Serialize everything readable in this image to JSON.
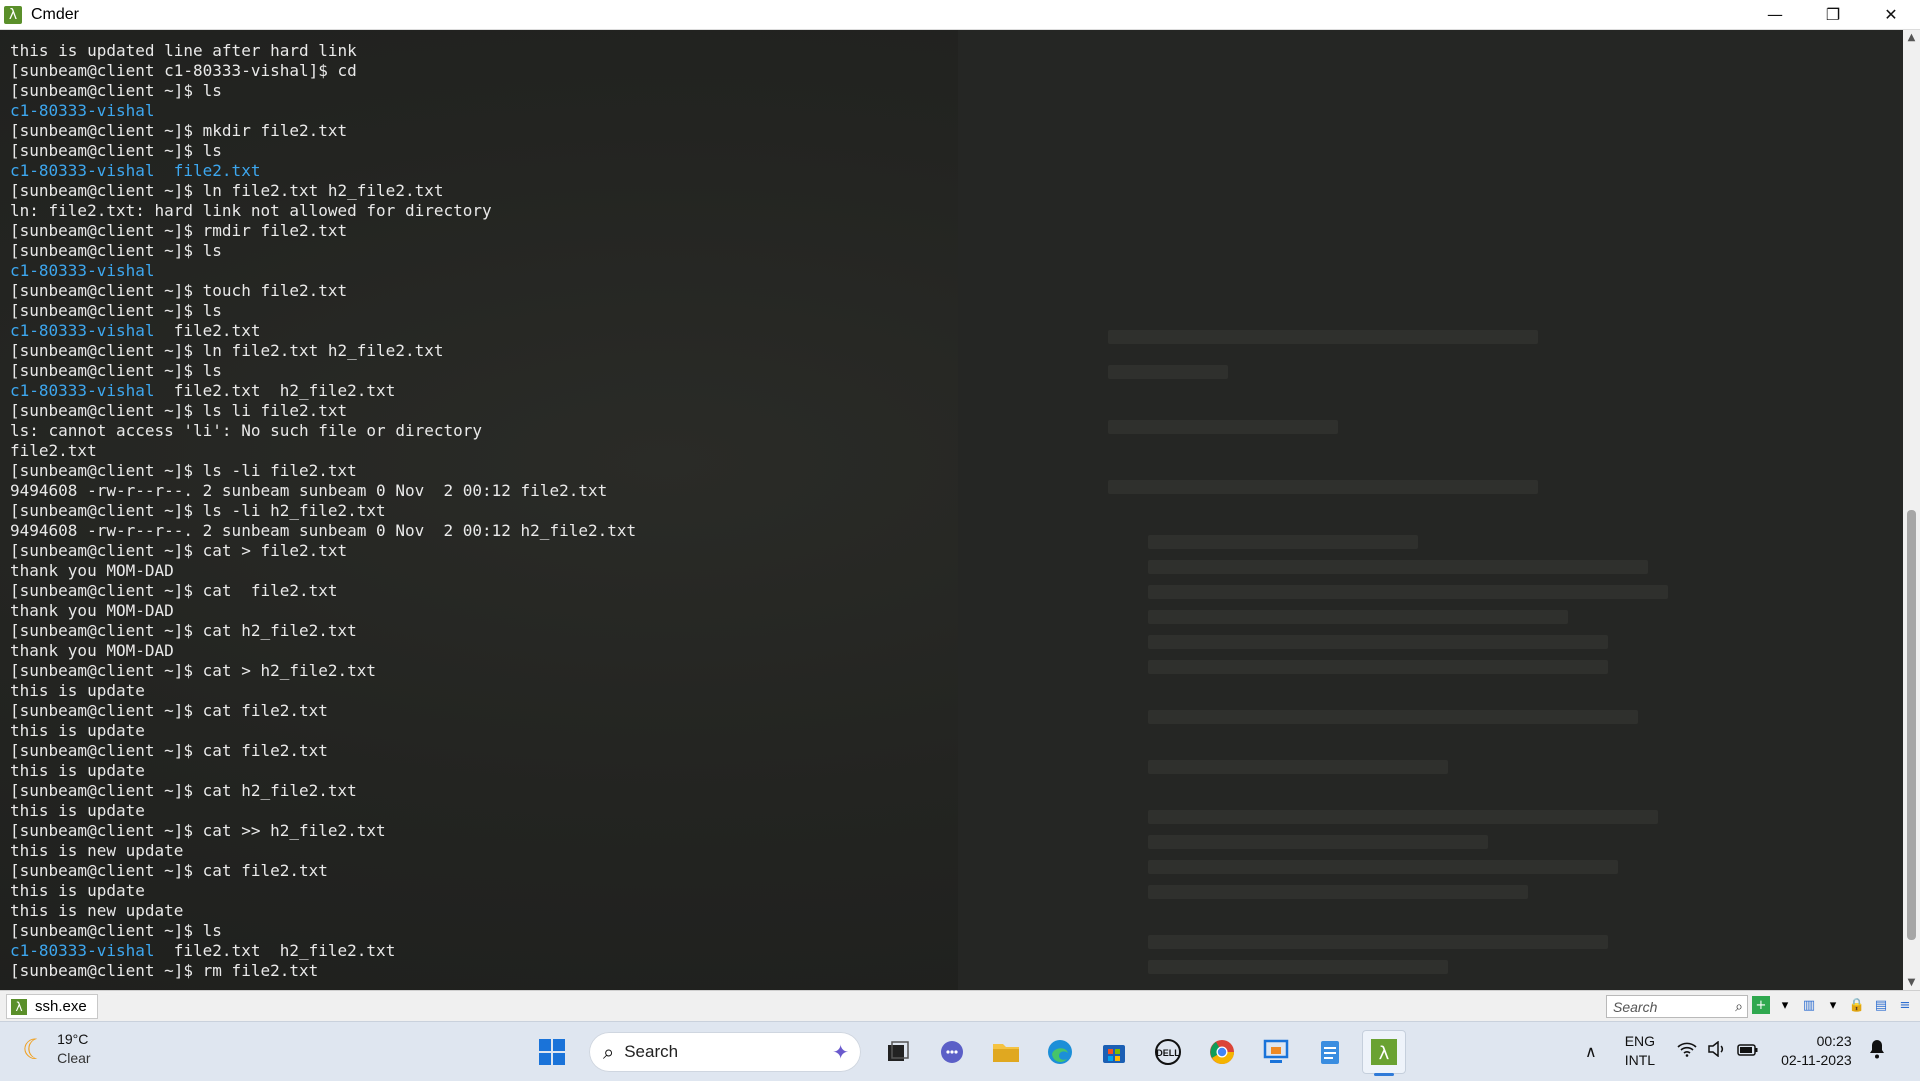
{
  "window": {
    "title": "Cmder",
    "app_icon": "λ",
    "controls": {
      "minimize": "—",
      "restore": "❐",
      "close": "✕"
    }
  },
  "terminal": {
    "colors": {
      "text": "#e9e9e9",
      "directory": "#3da7ef",
      "background": "#1b1d1b"
    },
    "lines": [
      {
        "text": "this is updated line after hard link",
        "color": "white"
      },
      {
        "text": "[sunbeam@client c1-80333-vishal]$ cd",
        "color": "white"
      },
      {
        "text": "[sunbeam@client ~]$ ls",
        "color": "white"
      },
      {
        "text": "c1-80333-vishal",
        "color": "blue"
      },
      {
        "text": "[sunbeam@client ~]$ mkdir file2.txt",
        "color": "white"
      },
      {
        "text": "[sunbeam@client ~]$ ls",
        "color": "white"
      },
      {
        "text": "c1-80333-vishal  file2.txt",
        "color": "blue"
      },
      {
        "text": "[sunbeam@client ~]$ ln file2.txt h2_file2.txt",
        "color": "white"
      },
      {
        "text": "ln: file2.txt: hard link not allowed for directory",
        "color": "white"
      },
      {
        "text": "[sunbeam@client ~]$ rmdir file2.txt",
        "color": "white"
      },
      {
        "text": "[sunbeam@client ~]$ ls",
        "color": "white"
      },
      {
        "text": "c1-80333-vishal",
        "color": "blue"
      },
      {
        "text": "[sunbeam@client ~]$ touch file2.txt",
        "color": "white"
      },
      {
        "text": "[sunbeam@client ~]$ ls",
        "color": "white"
      },
      {
        "text": "c1-80333-vishal",
        "color": "blue",
        "extra": "  file2.txt"
      },
      {
        "text": "[sunbeam@client ~]$ ln file2.txt h2_file2.txt",
        "color": "white"
      },
      {
        "text": "[sunbeam@client ~]$ ls",
        "color": "white"
      },
      {
        "text": "c1-80333-vishal",
        "color": "blue",
        "extra": "  file2.txt  h2_file2.txt"
      },
      {
        "text": "[sunbeam@client ~]$ ls li file2.txt",
        "color": "white"
      },
      {
        "text": "ls: cannot access 'li': No such file or directory",
        "color": "white"
      },
      {
        "text": "file2.txt",
        "color": "white"
      },
      {
        "text": "[sunbeam@client ~]$ ls -li file2.txt",
        "color": "white"
      },
      {
        "text": "9494608 -rw-r--r--. 2 sunbeam sunbeam 0 Nov  2 00:12 file2.txt",
        "color": "white"
      },
      {
        "text": "[sunbeam@client ~]$ ls -li h2_file2.txt",
        "color": "white"
      },
      {
        "text": "9494608 -rw-r--r--. 2 sunbeam sunbeam 0 Nov  2 00:12 h2_file2.txt",
        "color": "white"
      },
      {
        "text": "[sunbeam@client ~]$ cat > file2.txt",
        "color": "white"
      },
      {
        "text": "thank you MOM-DAD",
        "color": "white"
      },
      {
        "text": "[sunbeam@client ~]$ cat  file2.txt",
        "color": "white"
      },
      {
        "text": "thank you MOM-DAD",
        "color": "white"
      },
      {
        "text": "[sunbeam@client ~]$ cat h2_file2.txt",
        "color": "white"
      },
      {
        "text": "thank you MOM-DAD",
        "color": "white"
      },
      {
        "text": "[sunbeam@client ~]$ cat > h2_file2.txt",
        "color": "white"
      },
      {
        "text": "this is update",
        "color": "white"
      },
      {
        "text": "[sunbeam@client ~]$ cat file2.txt",
        "color": "white"
      },
      {
        "text": "this is update",
        "color": "white"
      },
      {
        "text": "[sunbeam@client ~]$ cat file2.txt",
        "color": "white"
      },
      {
        "text": "this is update",
        "color": "white"
      },
      {
        "text": "[sunbeam@client ~]$ cat h2_file2.txt",
        "color": "white"
      },
      {
        "text": "this is update",
        "color": "white"
      },
      {
        "text": "[sunbeam@client ~]$ cat >> h2_file2.txt",
        "color": "white"
      },
      {
        "text": "this is new update",
        "color": "white"
      },
      {
        "text": "[sunbeam@client ~]$ cat file2.txt",
        "color": "white"
      },
      {
        "text": "this is update",
        "color": "white"
      },
      {
        "text": "this is new update",
        "color": "white"
      },
      {
        "text": "[sunbeam@client ~]$ ls",
        "color": "white"
      },
      {
        "text": "c1-80333-vishal",
        "color": "blue",
        "extra": "  file2.txt  h2_file2.txt"
      },
      {
        "text": "[sunbeam@client ~]$ rm file2.txt",
        "color": "white"
      }
    ]
  },
  "status_bar": {
    "tab_label": "ssh.exe",
    "search_placeholder": "Search"
  },
  "taskbar": {
    "weather_temp": "19°C",
    "weather_condition": "Clear",
    "search_label": "Search",
    "language_top": "ENG",
    "language_bottom": "INTL",
    "time": "00:23",
    "date": "02-11-2023",
    "icons": [
      "start-icon",
      "task-view-icon",
      "chat-icon",
      "file-explorer-icon",
      "edge-icon",
      "store-icon",
      "dell-icon",
      "chrome-icon",
      "remote-desktop-icon",
      "notepad-icon",
      "cmder-icon"
    ]
  }
}
